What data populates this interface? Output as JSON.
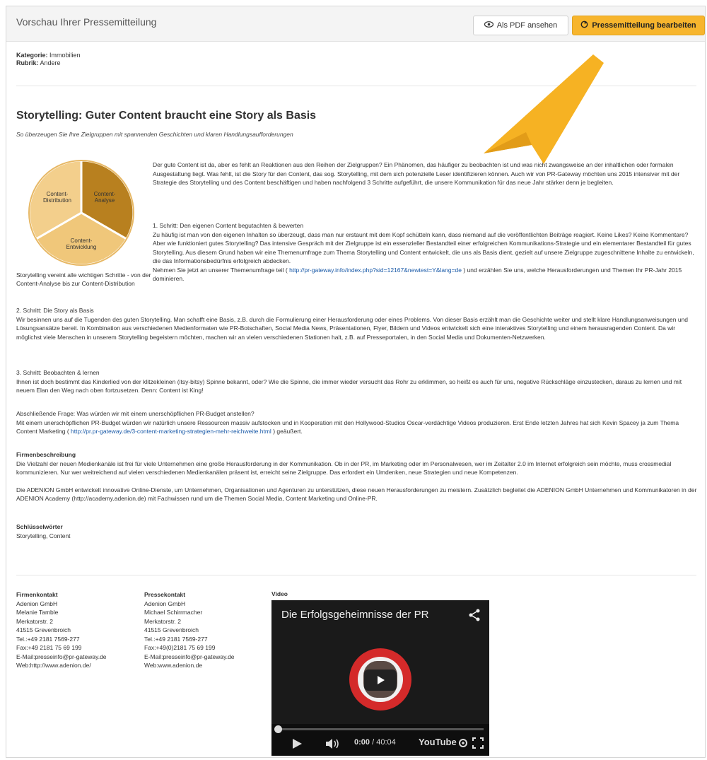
{
  "header": {
    "title": "Vorschau Ihrer Pressemitteilung",
    "pdf_label": "Als PDF ansehen",
    "edit_label": "Pressemitteilung bearbeiten"
  },
  "meta": {
    "category_label": "Kategorie:",
    "category_value": "Immobilien",
    "rubric_label": "Rubrik:",
    "rubric_value": "Andere"
  },
  "article": {
    "title": "Storytelling: Guter Content braucht eine Story als Basis",
    "subtitle": "So überzeugen Sie Ihre Zielgruppen mit spannenden Geschichten und klaren Handlungsaufforderungen",
    "intro": "Der gute Content ist da, aber es fehlt an Reaktionen aus den Reihen der Zielgruppen? Ein Phänomen, das häufiger zu beobachten ist und was nicht zwangsweise an der inhaltlichen oder formalen Ausgestaltung liegt. Was fehlt, ist die Story für den Content, das sog. Storytelling, mit dem sich potenzielle Leser identifizieren können. Auch wir von PR-Gateway möchten uns 2015 intensiver mit der Strategie des Storytelling und des Content beschäftigen und haben nachfolgend 3 Schritte aufgeführt, die unsere Kommunikation für das neue Jahr stärker denn je begleiten.",
    "step1_heading": "1. Schritt: Den eigenen Content begutachten & bewerten",
    "step1_text": "Zu häufig ist man von den eigenen Inhalten so überzeugt, dass man nur erstaunt mit dem Kopf schütteln kann, dass niemand auf die veröffentlichten Beiträge reagiert. Keine Likes? Keine Kommentare? Aber wie funktioniert gutes Storytelling? Das intensive Gespräch mit der Zielgruppe ist ein essenzieller Bestandteil einer erfolgreichen Kommunikations-Strategie und ein elementarer Bestandteil für gutes Storytelling. Aus diesem Grund haben wir eine Themenumfrage zum Thema Storytelling und Content entwickelt, die uns als Basis dient, gezielt auf unsere Zielgruppe zugeschnittene Inhalte zu entwickeln, die das Informationsbedürfnis erfolgreich abdecken.",
    "step1_link_pre": "Nehmen Sie jetzt an unserer Themenumfrage teil (",
    "step1_link": "http://pr-gateway.info/index.php?sid=12167&newtest=Y&lang=de",
    "step1_link_post": ") und erzählen Sie uns, welche Herausforderungen und Themen Ihr PR-Jahr 2015 dominieren.",
    "step2_heading": "2. Schritt: Die Story als Basis",
    "step2_text": "Wir besinnen uns auf die Tugenden des guten Storytelling. Man schafft eine Basis, z.B. durch die Formulierung einer Herausforderung oder eines Problems. Von dieser Basis erzählt man die Geschichte weiter und stellt klare Handlungsanweisungen und Lösungsansätze bereit. In Kombination aus verschiedenen Medienformaten wie PR-Botschaften, Social Media News, Präsentationen, Flyer, Bildern und Videos entwickelt sich eine interaktives Storytelling und einem herausragenden Content. Da wir möglichst viele Menschen in unserem Storytelling begeistern möchten, machen wir an vielen verschiedenen Stationen halt, z.B. auf Presseportalen, in den Social Media und Dokumenten-Netzwerken.",
    "step3_heading": "3. Schritt: Beobachten & lernen",
    "step3_text": "Ihnen ist doch bestimmt das Kinderlied von der klitzekleinen (itsy-bitsy) Spinne bekannt, oder? Wie die Spinne, die immer wieder versucht das Rohr zu erklimmen, so heißt es auch für uns, negative Rückschläge einzustecken, daraus zu lernen und mit neuem Elan den Weg nach oben fortzusetzen. Denn: Content ist King!",
    "final_heading": "Abschließende Frage: Was würden wir mit einem unerschöpflichen PR-Budget anstellen?",
    "final_text": "Mit einem unerschöpflichen PR-Budget würden wir natürlich unsere Ressourcen massiv aufstocken und in Kooperation mit den Hollywood-Studios Oscar-verdächtige Videos produzieren. Erst Ende letzten Jahres hat sich Kevin Spacey ja zum Thema Content Marketing (",
    "final_link": "http://pr.pr-gateway.de/3-content-marketing-strategien-mehr-reichweite.html",
    "final_link_post": ") geäußert.",
    "company_heading": "Firmenbeschreibung",
    "company_text1": "Die Vielzahl der neuen Medienkanäle ist frei für viele Unternehmen eine große Herausforderung in der Kommunikation. Ob in der PR, im Marketing oder im Personalwesen, wer im Zeitalter 2.0 im Internet erfolgreich sein möchte, muss crossmedial kommunizieren. Nur wer weitreichend auf vielen verschiedenen Medienkanälen präsent ist, erreicht seine Zielgruppe. Das erfordert ein Umdenken, neue Strategien und neue Kompetenzen.",
    "company_text2": "Die ADENION GmbH entwickelt innovative Online-Dienste, um Unternehmen, Organisationen und Agenturen zu unterstützen, diese neuen Herausforderungen zu meistern. Zusätzlich begleitet die ADENION GmbH Unternehmen und Kommunikatoren in der ADENION Academy (http://academy.adenion.de) mit Fachwissen rund um die Themen Social Media, Content Marketing und Online-PR.",
    "keywords_heading": "Schlüsselwörter",
    "keywords": "Storytelling, Content"
  },
  "chart": {
    "caption": "Storytelling vereint alle wichtigen Schritte - von der Content-Analyse bis zur Content-Distribution",
    "segments": [
      {
        "label1": "Content-",
        "label2": "Analyse",
        "color": "#b8801f"
      },
      {
        "label1": "Content-",
        "label2": "Entwicklung",
        "color": "#f0c77a"
      },
      {
        "label1": "Content-",
        "label2": "Distribution",
        "color": "#f3cf8c"
      }
    ]
  },
  "contacts": {
    "firm": {
      "heading": "Firmenkontakt",
      "lines": [
        "Adenion GmbH",
        "Melanie Tamble",
        "Merkatorstr. 2",
        "41515 Grevenbroich",
        "Tel.:+49 2181 7569-277",
        "Fax:+49 2181 75 69 199",
        "E-Mail:presseinfo@pr-gateway.de",
        "Web:http://www.adenion.de/"
      ]
    },
    "press": {
      "heading": "Pressekontakt",
      "lines": [
        "Adenion GmbH",
        "Michael Schirrmacher",
        "Merkatorstr. 2",
        "41515 Grevenbroich",
        "Tel.:+49 2181 7569-277",
        "Fax:+49(0)2181 75 69 199",
        "E-Mail:presseinfo@pr-gateway.de",
        "Web:www.adenion.de"
      ]
    }
  },
  "video": {
    "label": "Video",
    "title": "Die Erfolgsgeheimnisse der PR",
    "time_current": "0:00",
    "time_total": "/ 40:04",
    "brand": "YouTube",
    "progress": 0
  },
  "colors": {
    "accent": "#f7b52d",
    "link": "#1a5aa8",
    "arrow": "#f6b223"
  }
}
